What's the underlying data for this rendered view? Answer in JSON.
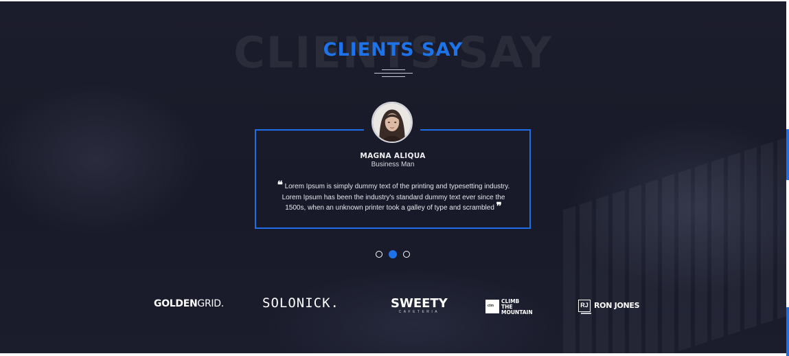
{
  "section": {
    "background_title": "CLIENTS SAY",
    "title": "CLIENTS SAY"
  },
  "testimonial": {
    "name": "MAGNA ALIQUA",
    "role": "Business Man",
    "quote": "Lorem Ipsum is simply dummy text of the printing and typesetting industry. Lorem Ipsum has been the industry's standard dummy text ever since the 1500s, when an unknown printer took a galley of type and scrambled",
    "open_quote": "❝",
    "close_quote": "❞"
  },
  "carousel": {
    "slide_count": 3,
    "active_index": 1
  },
  "logos": {
    "golden_bold": "GOLDEN",
    "golden_light": "GRID.",
    "solonick": "SOLONICK.",
    "sweety_main": "SWEETY",
    "sweety_sub": "CAFETERIA",
    "climb_badge": "ctm",
    "climb_line1": "CLIMB",
    "climb_line2": "THE",
    "climb_line3": "MOUNTAIN",
    "rj_badge": "RJ",
    "rj_name": "RON JONES"
  },
  "colors": {
    "accent": "#1e73e8",
    "background": "#1a1b2a",
    "text": "#ffffff"
  }
}
